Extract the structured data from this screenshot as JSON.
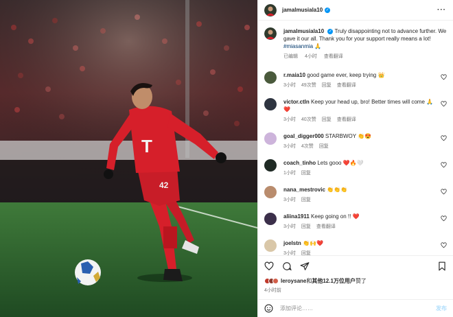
{
  "post": {
    "author": "jamalmusiala10",
    "verified_icon": "verified-badge-icon",
    "more_icon": "more-options-icon"
  },
  "caption": {
    "username": "jamalmusiala10",
    "text": "Truly disappointing not to advance further. We gave it our all. Thank you for your support really means a lot!",
    "hashtag": "#miasanmia",
    "emoji": "🙏",
    "edited": "已编辑",
    "time": "4小时",
    "translate": "查看翻译"
  },
  "comments": [
    {
      "username": "r.maia10",
      "text": "good game ever, keep trying 👑",
      "time": "3小时",
      "likes": "49次赞",
      "reply": "回复",
      "translate": "查看翻译",
      "avatar_color": "#4a5a3c"
    },
    {
      "username": "victor.ctln",
      "text": "Keep your head up, bro! Better times will come 🙏❤️",
      "time": "3小时",
      "likes": "40次赞",
      "reply": "回复",
      "translate": "查看翻译",
      "avatar_color": "#2e3440"
    },
    {
      "username": "goal_digger000",
      "text": "STARBWOY 👏😍",
      "time": "3小时",
      "likes": "4次赞",
      "reply": "回复",
      "translate": "",
      "avatar_color": "#cdb4db"
    },
    {
      "username": "coach_tinho",
      "text": "Lets gooo ❤️🔥🤍",
      "time": "1小时",
      "likes": "",
      "reply": "回复",
      "translate": "",
      "avatar_color": "#1f2a24"
    },
    {
      "username": "nana_mestrovic",
      "text": "👏👏👏",
      "time": "3小时",
      "likes": "",
      "reply": "回复",
      "translate": "",
      "avatar_color": "#b98c6d"
    },
    {
      "username": "aliina1911",
      "text": "Keep going on !! ❤️",
      "time": "3小时",
      "likes": "",
      "reply": "回复",
      "translate": "查看翻译",
      "avatar_color": "#3b2f4a"
    },
    {
      "username": "joelstn",
      "text": "👏🙌❤️",
      "time": "3小时",
      "likes": "",
      "reply": "回复",
      "translate": "",
      "avatar_color": "#d9c7a8"
    }
  ],
  "actions": {
    "like_icon": "heart-icon",
    "comment_icon": "comment-bubble-icon",
    "share_icon": "send-icon",
    "save_icon": "bookmark-icon"
  },
  "likes": {
    "user": "leroysane",
    "connector": "和",
    "others": "其他12.1万位用户",
    "suffix": "赞了",
    "avatar_colors": [
      "#c0392b",
      "#8e3b2f",
      "#d35f4a"
    ]
  },
  "timestamp": "4小时前",
  "add_comment": {
    "placeholder": "添加评论……",
    "post_label": "发布",
    "emoji_icon": "smiley-icon"
  },
  "colors": {
    "link_blue": "#00376b",
    "verified_blue": "#0095f6",
    "heart_red": "#ed4956",
    "kit_red": "#d61f2a"
  }
}
